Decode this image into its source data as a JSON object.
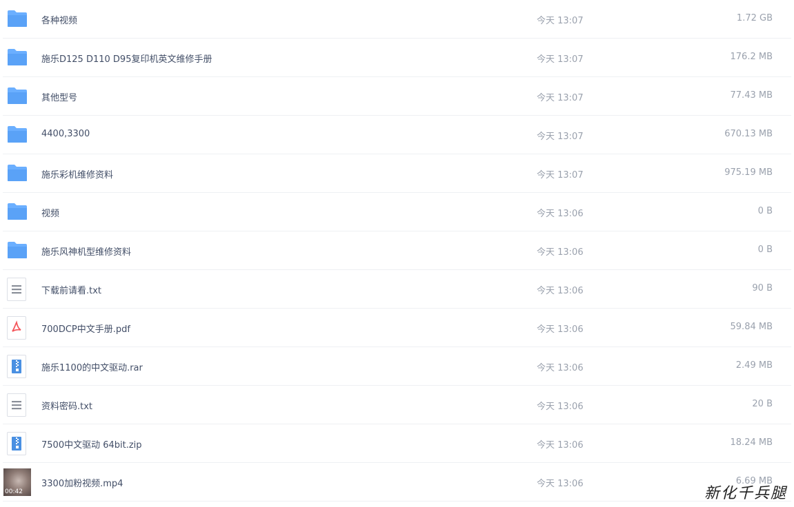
{
  "files": [
    {
      "name": "各种视频",
      "time": "今天 13:07",
      "size": "1.72 GB",
      "type": "folder"
    },
    {
      "name": "施乐D125 D110 D95复印机英文维修手册",
      "time": "今天 13:07",
      "size": "176.2 MB",
      "type": "folder"
    },
    {
      "name": "其他型号",
      "time": "今天 13:07",
      "size": "77.43 MB",
      "type": "folder"
    },
    {
      "name": "4400,3300",
      "time": "今天 13:07",
      "size": "670.13 MB",
      "type": "folder"
    },
    {
      "name": "施乐彩机维修资料",
      "time": "今天 13:07",
      "size": "975.19 MB",
      "type": "folder"
    },
    {
      "name": "视频",
      "time": "今天 13:06",
      "size": "0 B",
      "type": "folder"
    },
    {
      "name": "施乐风神机型维修资料",
      "time": "今天 13:06",
      "size": "0 B",
      "type": "folder"
    },
    {
      "name": "下载前请看.txt",
      "time": "今天 13:06",
      "size": "90 B",
      "type": "txt"
    },
    {
      "name": "700DCP中文手册.pdf",
      "time": "今天 13:06",
      "size": "59.84 MB",
      "type": "pdf"
    },
    {
      "name": "施乐1100的中文驱动.rar",
      "time": "今天 13:06",
      "size": "2.49 MB",
      "type": "archive"
    },
    {
      "name": "资料密码.txt",
      "time": "今天 13:06",
      "size": "20 B",
      "type": "txt"
    },
    {
      "name": "7500中文驱动 64bit.zip",
      "time": "今天 13:06",
      "size": "18.24 MB",
      "type": "archive"
    },
    {
      "name": "3300加粉视频.mp4",
      "time": "今天 13:06",
      "size": "6.69 MB",
      "type": "video",
      "duration": "00:42"
    }
  ],
  "icons": {
    "folder": "folder-icon",
    "txt": "text-file-icon",
    "pdf": "pdf-file-icon",
    "archive": "archive-file-icon",
    "video": "video-thumbnail"
  },
  "colors": {
    "folder": "#6bafff",
    "pdf": "#f4555a",
    "archive": "#4a90e2",
    "txt": "#8a8f99"
  },
  "watermark": "新化千兵腿"
}
